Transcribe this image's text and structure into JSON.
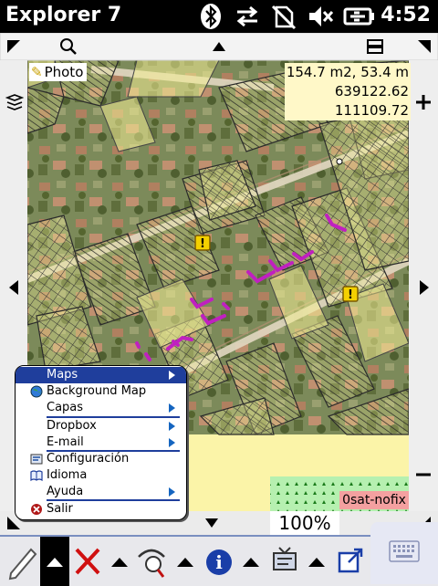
{
  "status_bar": {
    "app_title": "Explorer 7",
    "time": "4:52",
    "icons": [
      "bluetooth-icon",
      "data-sync-icon",
      "no-sim-icon",
      "volume-mute-icon",
      "battery-charging-icon"
    ]
  },
  "map": {
    "photo_label": "Photo",
    "measurement": {
      "area_perimeter": "154.7 m2, 53.4 m",
      "x_coord": "639122.62",
      "y_coord": "111109.72"
    },
    "satellite_source": "0sat-nofix",
    "zoom_level": "100%",
    "colors": {
      "parcel_fill": "#f4ef96",
      "hatch": "#2b2b2b",
      "track": "#c020c0",
      "warning": "#f4d000"
    }
  },
  "menu": {
    "items": [
      {
        "label": "Maps",
        "submenu": true,
        "selected": true
      },
      {
        "label": "Background Map",
        "submenu": false,
        "icon": "globe-icon"
      },
      {
        "label": "Capas",
        "submenu": true
      },
      {
        "label": "Dropbox",
        "submenu": true
      },
      {
        "label": "E-mail",
        "submenu": true
      },
      {
        "label": "Configuración",
        "submenu": false,
        "icon": "settings-icon"
      },
      {
        "label": "Idioma",
        "submenu": false,
        "icon": "language-book-icon"
      },
      {
        "label": "Ayuda",
        "submenu": true
      },
      {
        "label": "Salir",
        "submenu": false,
        "icon": "exit-icon"
      }
    ]
  },
  "toolbar": {
    "buttons": [
      "pencil-tool-icon",
      "delete-icon",
      "gps-select-icon",
      "info-icon",
      "gps-settings-icon",
      "export-icon",
      "keyboard-icon"
    ]
  }
}
